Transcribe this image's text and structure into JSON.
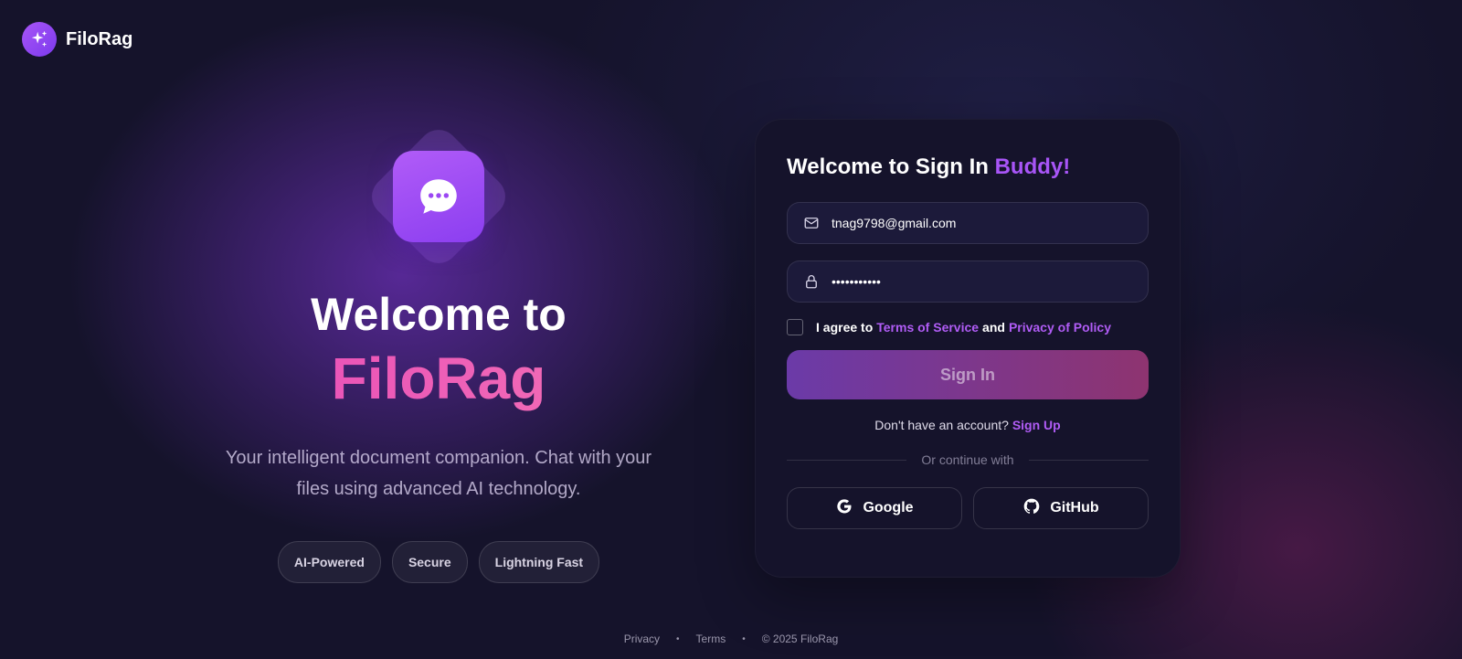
{
  "brand": {
    "name": "FiloRag",
    "logo_icon": "sparkles-icon"
  },
  "hero": {
    "icon": "chat-bubble-icon",
    "title": "Welcome to",
    "brand_name": "FiloRag",
    "subtitle": "Your intelligent document companion. Chat with your files using advanced AI technology.",
    "chips": [
      "AI-Powered",
      "Secure",
      "Lightning Fast"
    ]
  },
  "signin": {
    "title_prefix": "Welcome to Sign In",
    "title_accent": "Buddy!",
    "email": {
      "value": "tnag9798@gmail.com",
      "icon": "mail-icon"
    },
    "password": {
      "value": "•••••••••••",
      "icon": "lock-icon"
    },
    "agree": {
      "prefix": "I agree to",
      "terms_link": "Terms of Service",
      "and": "and",
      "privacy_link": "Privacy of Policy"
    },
    "button_label": "Sign In",
    "signup_prompt": "Don't have an account?",
    "signup_link": "Sign Up",
    "divider_text": "Or continue with",
    "social": {
      "google": "Google",
      "github": "GitHub"
    }
  },
  "footer": {
    "privacy": "Privacy",
    "terms": "Terms",
    "copyright": "© 2025 FiloRag"
  },
  "colors": {
    "accent": "#a855f7",
    "brand_gradient_start": "#e74bb8",
    "brand_gradient_end": "#f472b6",
    "button_gradient_start": "#6b3aa8",
    "button_gradient_end": "#8e3470",
    "background": "#15132b"
  }
}
